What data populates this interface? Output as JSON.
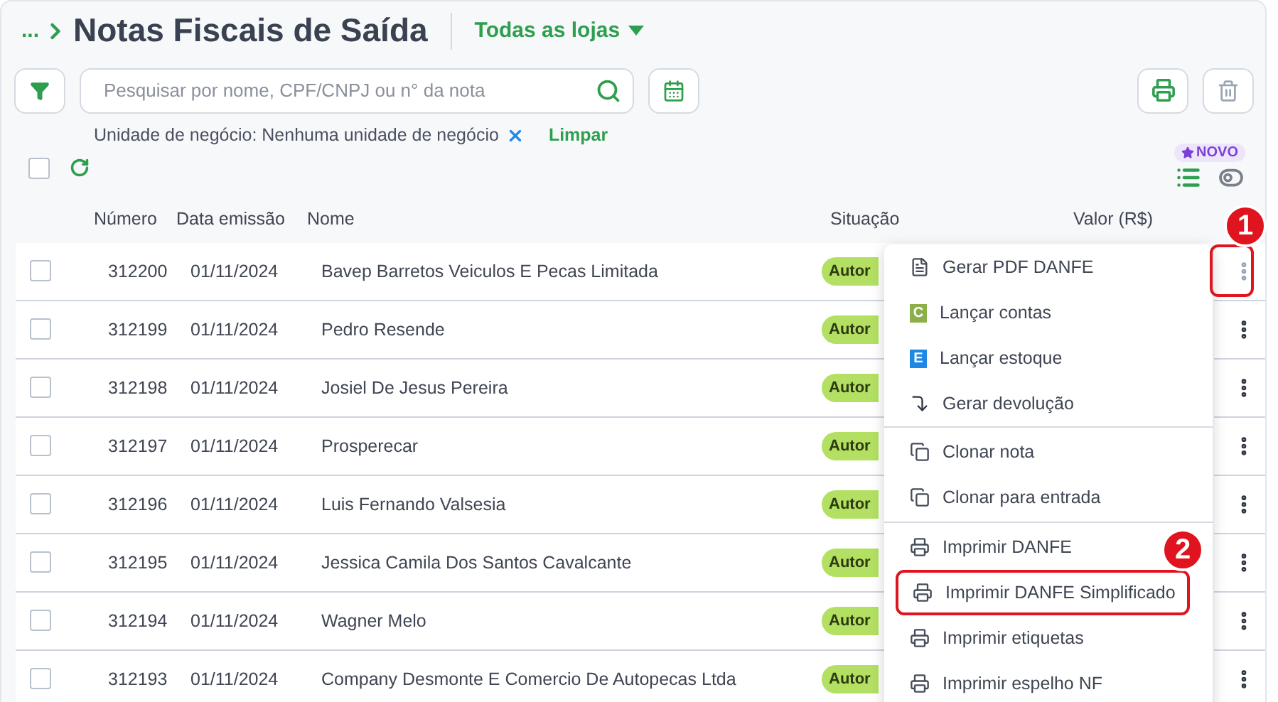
{
  "breadcrumb": {
    "ellipsis": "...",
    "title": "Notas Fiscais de Saída",
    "store_selector": "Todas as lojas"
  },
  "search": {
    "placeholder": "Pesquisar por nome, CPF/CNPJ ou n° da nota"
  },
  "filter_chip": {
    "label": "Unidade de negócio: Nenhuma unidade de negócio",
    "clear": "Limpar"
  },
  "new_badge": "NOVO",
  "select_all_checked": false,
  "table": {
    "columns": [
      "Número",
      "Data emissão",
      "Nome",
      "Situação",
      "Valor (R$)"
    ],
    "rows": [
      {
        "numero": "312200",
        "data": "01/11/2024",
        "nome": "Bavep Barretos Veiculos E Pecas Limitada",
        "situacao": "Autor",
        "checked": false,
        "menu_open": true
      },
      {
        "numero": "312199",
        "data": "01/11/2024",
        "nome": "Pedro Resende",
        "situacao": "Autor",
        "checked": false,
        "menu_open": false
      },
      {
        "numero": "312198",
        "data": "01/11/2024",
        "nome": "Josiel De Jesus Pereira",
        "situacao": "Autor",
        "checked": false,
        "menu_open": false
      },
      {
        "numero": "312197",
        "data": "01/11/2024",
        "nome": "Prosperecar",
        "situacao": "Autor",
        "checked": false,
        "menu_open": false
      },
      {
        "numero": "312196",
        "data": "01/11/2024",
        "nome": "Luis Fernando Valsesia",
        "situacao": "Autor",
        "checked": false,
        "menu_open": false
      },
      {
        "numero": "312195",
        "data": "01/11/2024",
        "nome": "Jessica Camila Dos Santos Cavalcante",
        "situacao": "Autor",
        "checked": false,
        "menu_open": false
      },
      {
        "numero": "312194",
        "data": "01/11/2024",
        "nome": "Wagner Melo",
        "situacao": "Autor",
        "checked": false,
        "menu_open": false
      },
      {
        "numero": "312193",
        "data": "01/11/2024",
        "nome": "Company Desmonte E Comercio De Autopecas Ltda",
        "situacao": "Autor",
        "checked": false,
        "menu_open": false
      }
    ]
  },
  "context_menu": {
    "groups": [
      [
        {
          "label": "Gerar PDF DANFE",
          "kind": "pdf",
          "highlighted": false
        },
        {
          "label": "Lançar contas",
          "kind": "letter",
          "letter": "C",
          "color": "#8bb04a",
          "highlighted": false
        },
        {
          "label": "Lançar estoque",
          "kind": "letter",
          "letter": "E",
          "color": "#1e88e5",
          "highlighted": false
        },
        {
          "label": "Gerar devolução",
          "kind": "return",
          "highlighted": false
        }
      ],
      [
        {
          "label": "Clonar nota",
          "kind": "clone",
          "highlighted": false
        },
        {
          "label": "Clonar para entrada",
          "kind": "clone",
          "highlighted": false
        }
      ],
      [
        {
          "label": "Imprimir DANFE",
          "kind": "print",
          "highlighted": false
        },
        {
          "label": "Imprimir DANFE Simplificado",
          "kind": "print",
          "highlighted": true
        },
        {
          "label": "Imprimir etiquetas",
          "kind": "print",
          "highlighted": false
        },
        {
          "label": "Imprimir espelho NF",
          "kind": "print",
          "highlighted": false
        }
      ]
    ]
  },
  "callouts": [
    "1",
    "2"
  ]
}
